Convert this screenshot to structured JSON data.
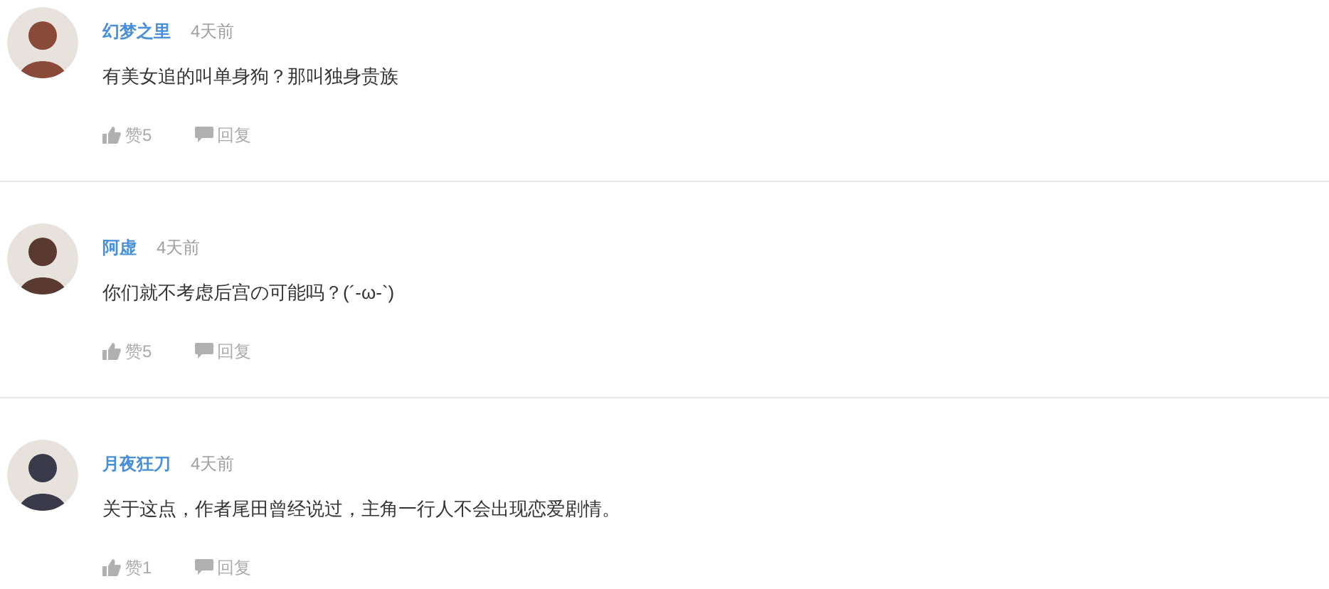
{
  "comments": [
    {
      "author": "幻梦之里",
      "time": "4天前",
      "text": "有美女追的叫单身狗？那叫独身贵族",
      "likes": "赞5",
      "reply": "回复"
    },
    {
      "author": "阿虚",
      "time": "4天前",
      "text": "你们就不考虑后宫の可能吗？(´-ω-`)",
      "likes": "赞5",
      "reply": "回复"
    },
    {
      "author": "月夜狂刀",
      "time": "4天前",
      "text": "关于这点，作者尾田曾经说过，主角一行人不会出现恋爱剧情。",
      "likes": "赞1",
      "reply": "回复"
    }
  ]
}
